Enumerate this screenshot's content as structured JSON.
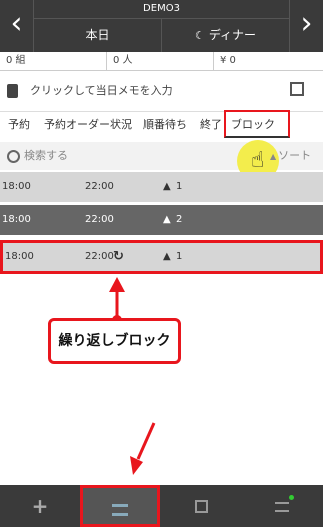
{
  "header": {
    "shop_name": "DEMO3",
    "date_label": "本日",
    "meal_label": "ディナー"
  },
  "stats": {
    "groups": "0 組",
    "people": "0 人",
    "amount": "¥ 0"
  },
  "memo": {
    "text": "クリックして当日メモを入力"
  },
  "tabs": [
    {
      "label": "予約"
    },
    {
      "label": "予約オーダー状況"
    },
    {
      "label": "順番待ち"
    },
    {
      "label": "終了"
    },
    {
      "label": "ブロック"
    }
  ],
  "search": {
    "placeholder": "検索する",
    "sort_label": "ソート"
  },
  "rows": [
    {
      "start": "18:00",
      "end": "22:00",
      "count": "1"
    },
    {
      "start": "18:00",
      "end": "22:00",
      "count": "2"
    },
    {
      "start": "18:00",
      "end": "22:00",
      "count": "1"
    }
  ],
  "annotation": {
    "callout_text": "繰り返しブロック"
  },
  "colors": {
    "accent_red": "#e8161d",
    "header_bg": "#3a3a3a",
    "cursor_highlight": "#f3ec3a"
  }
}
